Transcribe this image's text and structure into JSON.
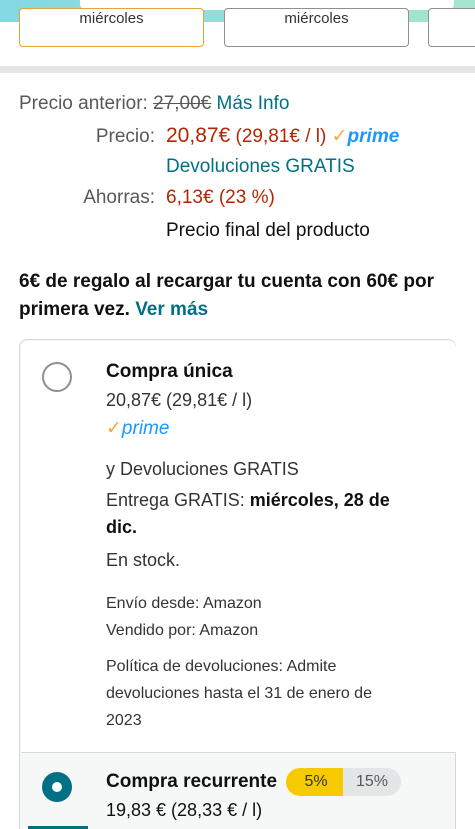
{
  "delivery_tiles": [
    {
      "label": "miércoles",
      "selected": true
    },
    {
      "label": "miércoles",
      "selected": false
    }
  ],
  "prices": {
    "previous_label": "Precio anterior:",
    "previous_value": "27,00€",
    "more_info": "Más Info",
    "price_label": "Precio:",
    "price_value": "20,87€",
    "unit_price": "(29,81€ / l)",
    "prime": "prime",
    "returns": "Devoluciones GRATIS",
    "savings_label": "Ahorras:",
    "savings_value": "6,13€ (23 %)",
    "final_note": "Precio final del producto"
  },
  "promo": {
    "text": "6€ de regalo al recargar tu cuenta con 60€ por primera vez.",
    "link": "Ver más"
  },
  "one_time": {
    "title": "Compra única",
    "price": "20,87€ (29,81€ / l)",
    "prime": "prime",
    "returns": "y Devoluciones GRATIS",
    "delivery_prefix": "Entrega GRATIS:",
    "delivery_date_line1": "miércoles, 28 de",
    "delivery_date_line2": "dic.",
    "stock": "En stock.",
    "ships_from": "Envío desde: Amazon",
    "sold_by": "Vendido por: Amazon",
    "return_policy_line1": "Política de devoluciones: Admite",
    "return_policy_line2": "devoluciones hasta el 31 de enero de",
    "return_policy_line3": "2023",
    "selected": false
  },
  "subscribe": {
    "title": "Compra recurrente",
    "discount_low": "5%",
    "discount_high": "15%",
    "price": "19,83 € (28,33 € / l)",
    "selected": true
  },
  "colors": {
    "link": "#007185",
    "price": "#b12704",
    "prime": "#1a98ff",
    "badge": "#f7ca00"
  }
}
